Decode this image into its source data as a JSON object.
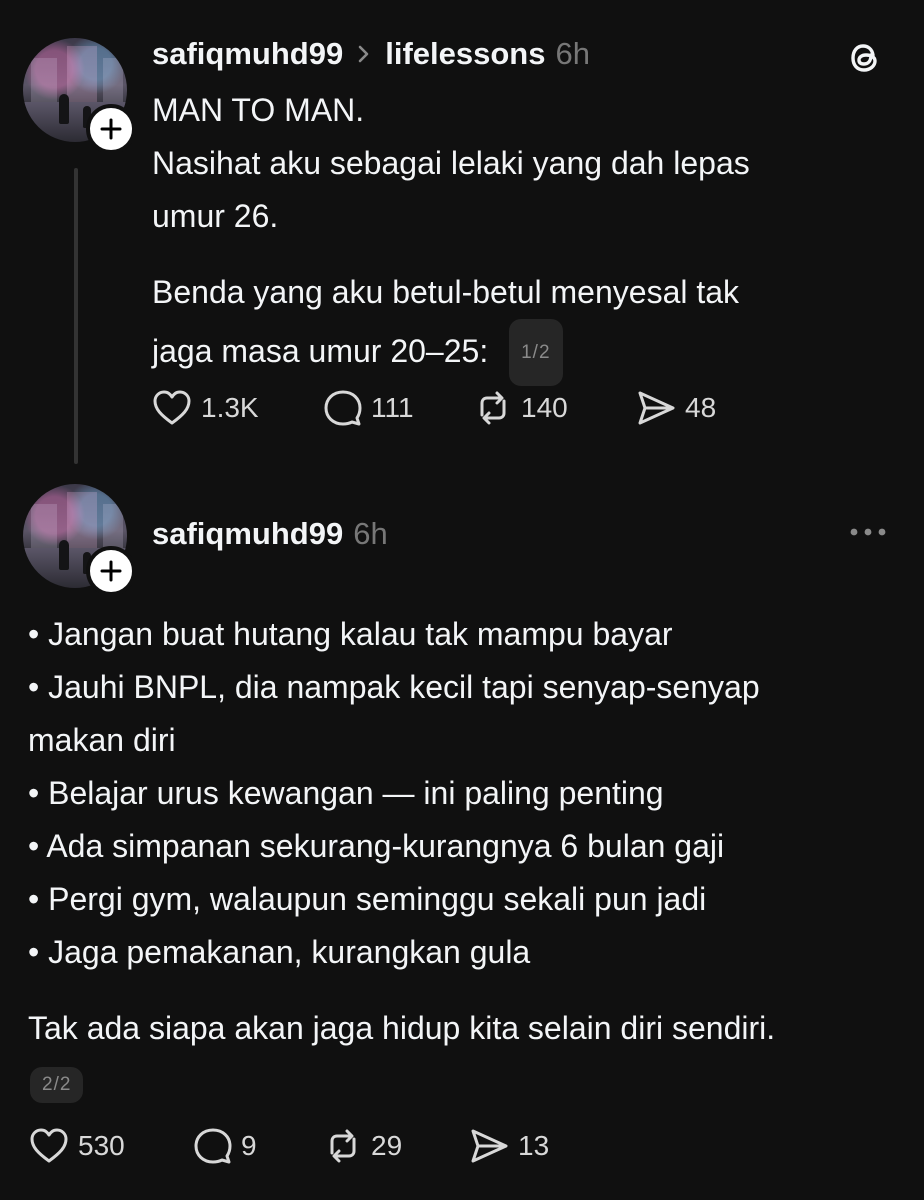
{
  "post1": {
    "username": "safiqmuhd99",
    "topic": "lifelessons",
    "time": "6h",
    "lines": [
      "MAN TO MAN.",
      "Nasihat aku sebagai lelaki yang dah lepas",
      "umur 26.",
      "Benda yang aku betul-betul menyesal tak",
      "jaga masa umur 20–25:"
    ],
    "page_indicator": "1/2",
    "actions": {
      "likes": "1.3K",
      "replies": "111",
      "reposts": "140",
      "shares": "48"
    }
  },
  "post2": {
    "username": "safiqmuhd99",
    "time": "6h",
    "lines": [
      "• Jangan buat hutang kalau tak mampu bayar",
      "• Jauhi BNPL, dia nampak kecil tapi senyap-senyap",
      "makan diri",
      "• Belajar urus kewangan — ini paling penting",
      "• Ada simpanan sekurang-kurangnya 6 bulan gaji",
      "• Pergi gym, walaupun seminggu sekali pun jadi",
      "• Jaga pemakanan, kurangkan gula",
      "Tak ada siapa akan jaga hidup kita selain diri sendiri."
    ],
    "page_indicator": "2/2",
    "actions": {
      "likes": "530",
      "replies": "9",
      "reposts": "29",
      "shares": "13"
    }
  },
  "icons": {
    "follow": "plus-icon",
    "topic_separator": "chevron-right-icon",
    "app_logo": "threads-logo-icon",
    "more": "more-horizontal-icon",
    "like": "heart-icon",
    "reply": "comment-icon",
    "repost": "repost-icon",
    "share": "send-icon"
  },
  "colors": {
    "background": "#101010",
    "text": "#f3f5f7",
    "muted": "#777777",
    "pill_bg": "#262626"
  }
}
